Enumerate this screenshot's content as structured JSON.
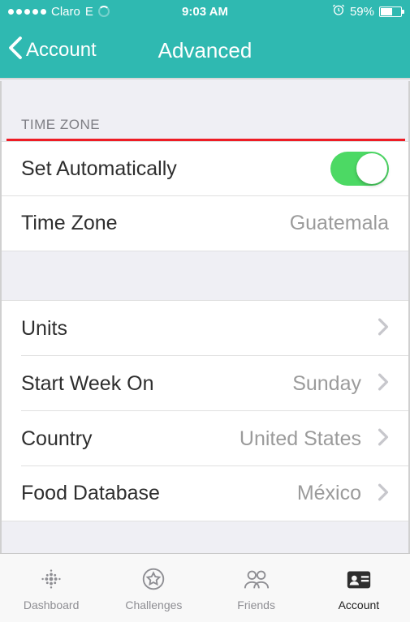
{
  "status": {
    "carrier": "Claro",
    "network": "E",
    "time": "9:03 AM",
    "battery_pct": "59%"
  },
  "nav": {
    "back_label": "Account",
    "title": "Advanced"
  },
  "sections": {
    "timezone_header": "TIME ZONE",
    "set_auto_label": "Set Automatically",
    "set_auto_on": true,
    "timezone_label": "Time Zone",
    "timezone_value": "Guatemala",
    "units_label": "Units",
    "startweek_label": "Start Week On",
    "startweek_value": "Sunday",
    "country_label": "Country",
    "country_value": "United States",
    "fooddb_label": "Food Database",
    "fooddb_value": "México"
  },
  "tabs": {
    "dashboard": "Dashboard",
    "challenges": "Challenges",
    "friends": "Friends",
    "account": "Account"
  }
}
